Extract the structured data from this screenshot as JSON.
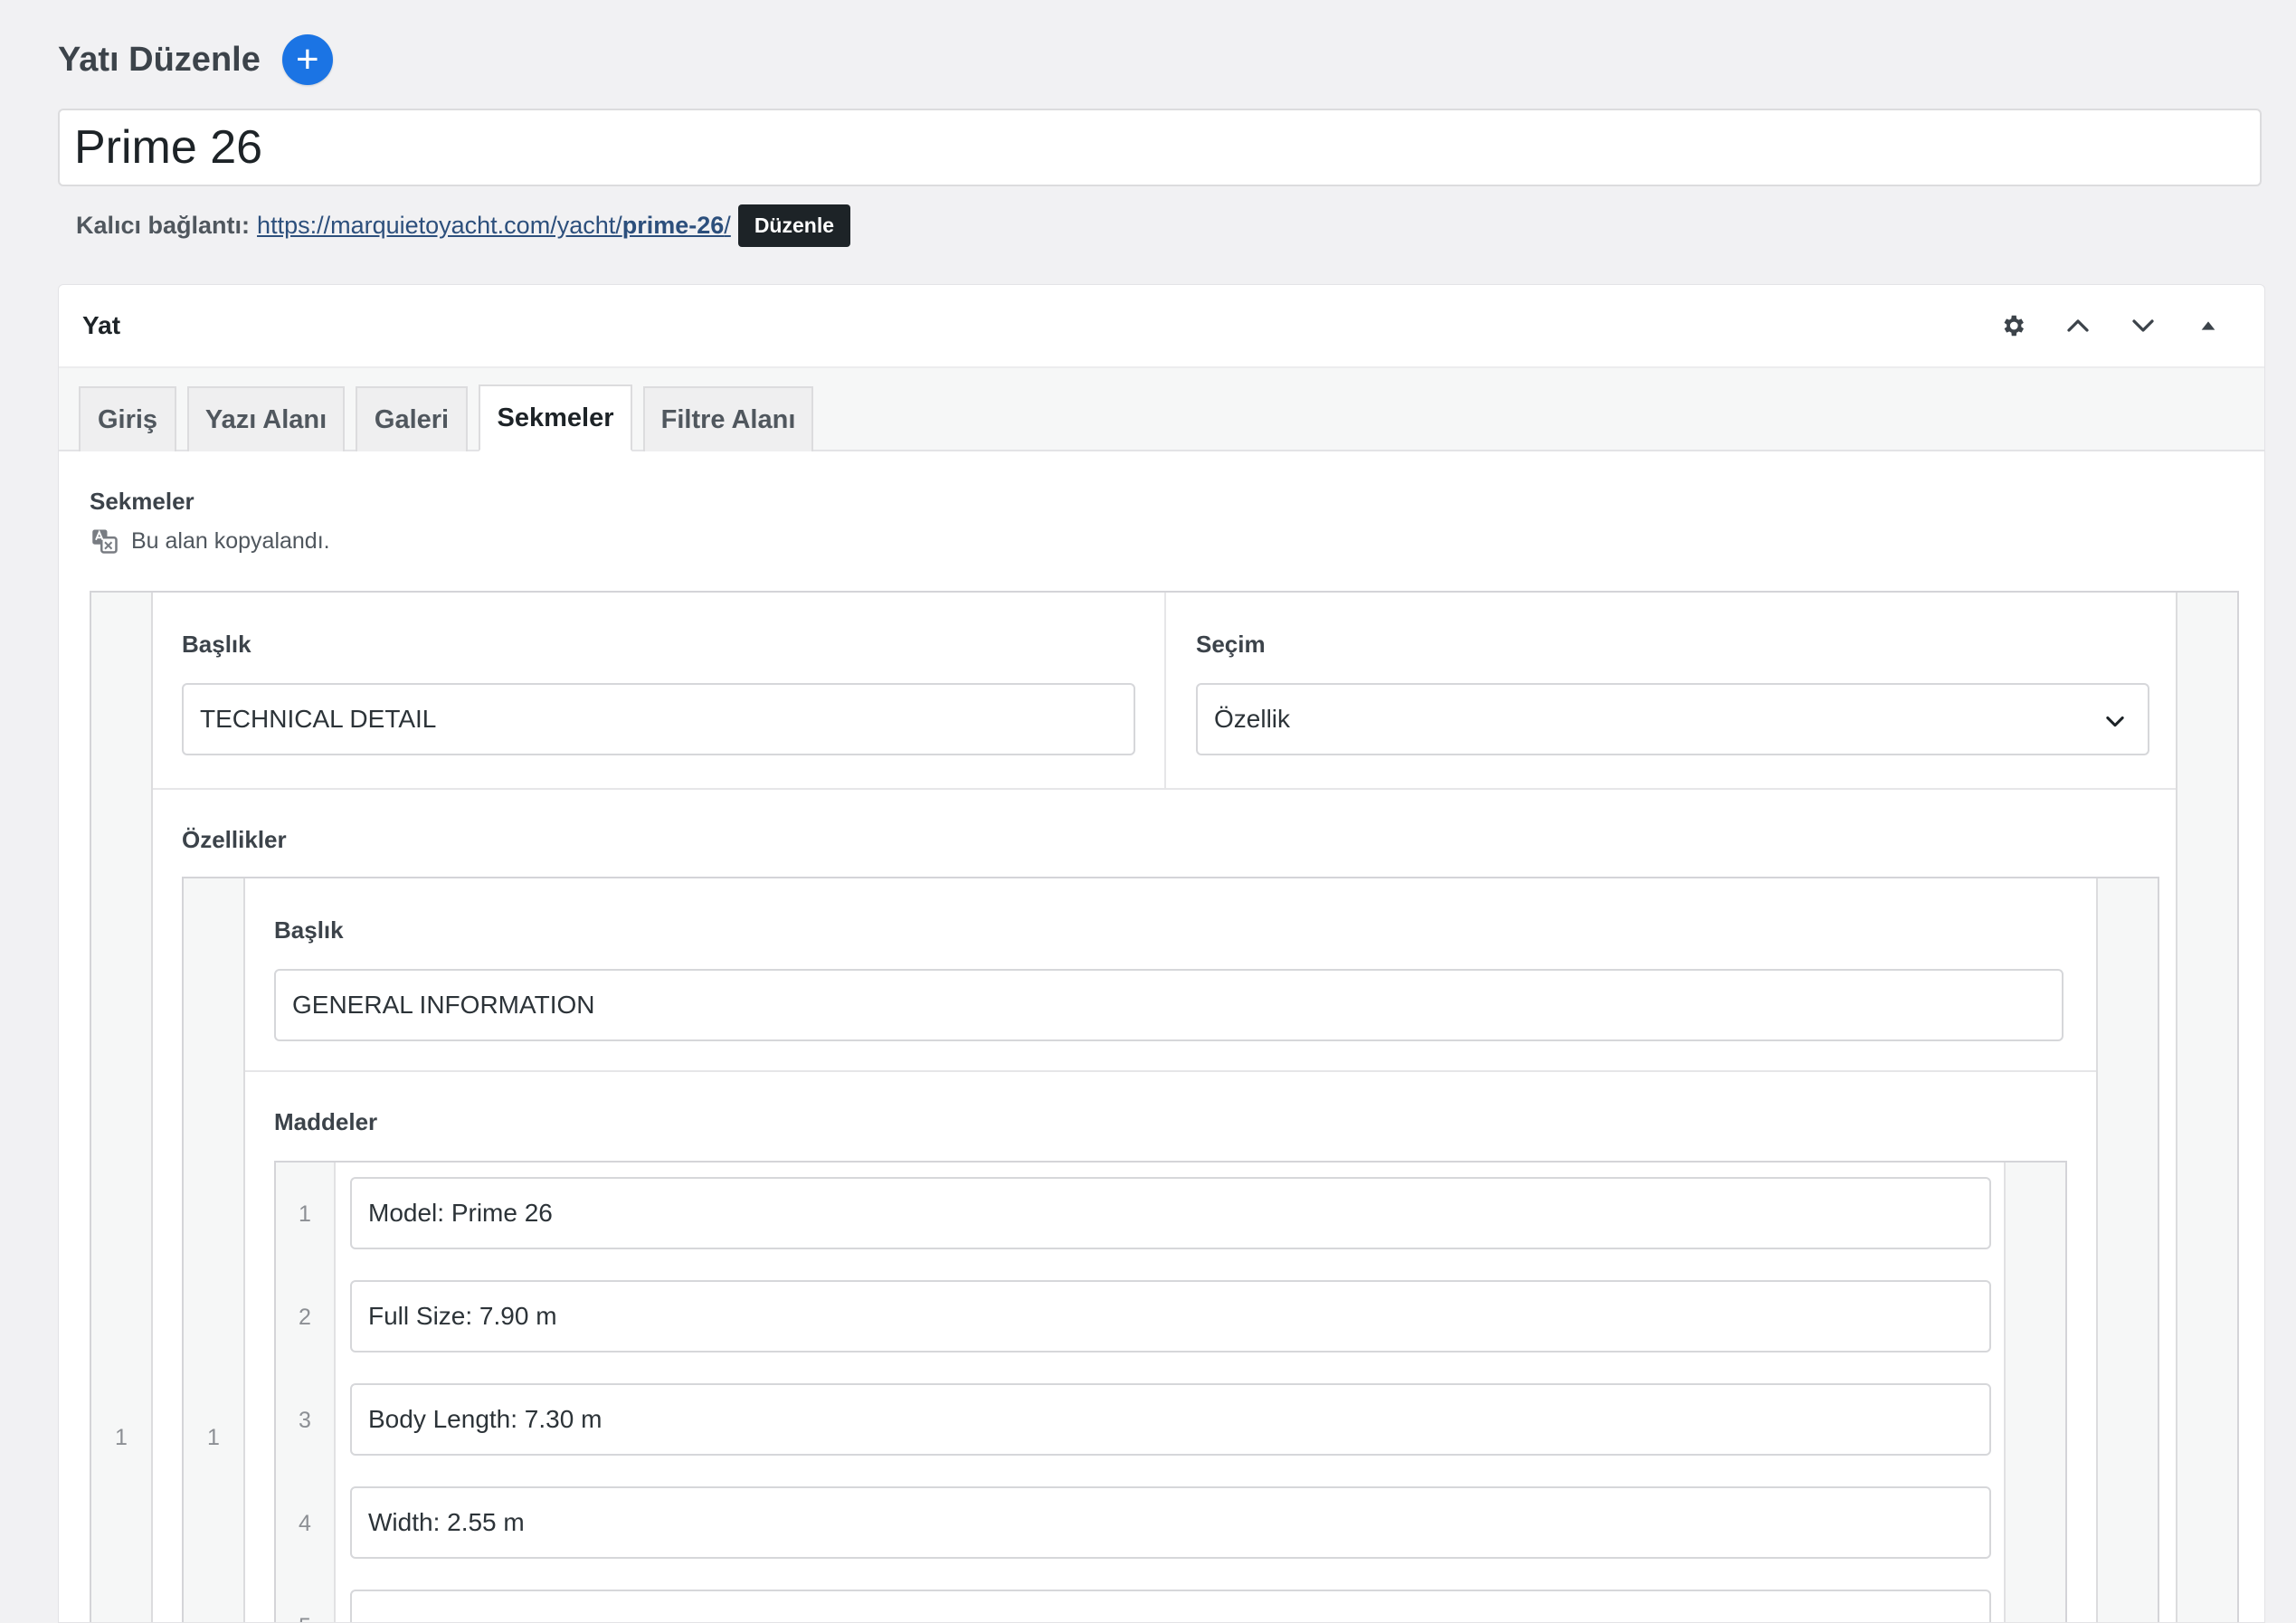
{
  "header": {
    "title": "Yatı Düzenle",
    "add_button": "+"
  },
  "post": {
    "title": "Prime 26"
  },
  "permalink": {
    "label": "Kalıcı bağlantı:",
    "url_base": "https://marquietoyacht.com/yacht/",
    "slug": "prime-26",
    "url_trail": "/",
    "edit_label": "Düzenle"
  },
  "postbox": {
    "title": "Yat",
    "controls": [
      "gear-icon",
      "chevron-up-icon",
      "chevron-down-icon",
      "triangle-up-icon"
    ]
  },
  "tabs": [
    {
      "label": "Giriş",
      "active": false
    },
    {
      "label": "Yazı Alanı",
      "active": false
    },
    {
      "label": "Galeri",
      "active": false
    },
    {
      "label": "Sekmeler",
      "active": true
    },
    {
      "label": "Filtre Alanı",
      "active": false
    }
  ],
  "section": {
    "label": "Sekmeler",
    "copied_note": "Bu alan kopyalandı."
  },
  "tab_row": {
    "row_number": "1",
    "title_label": "Başlık",
    "title_value": "TECHNICAL DETAIL",
    "choice_label": "Seçim",
    "choice_value": "Özellik",
    "features_label": "Özellikler",
    "feature": {
      "row_number": "1",
      "title_label": "Başlık",
      "title_value": "GENERAL INFORMATION",
      "items_label": "Maddeler",
      "items": [
        {
          "number": "1",
          "value": "Model: Prime 26"
        },
        {
          "number": "2",
          "value": "Full Size: 7.90 m"
        },
        {
          "number": "3",
          "value": "Body Length: 7.30 m"
        },
        {
          "number": "4",
          "value": "Width: 2.55 m"
        },
        {
          "number": "5",
          "value": ""
        }
      ]
    }
  },
  "colors": {
    "background": "#f1f1f3",
    "accent": "#1b74e4",
    "link": "#2c4f7c"
  }
}
